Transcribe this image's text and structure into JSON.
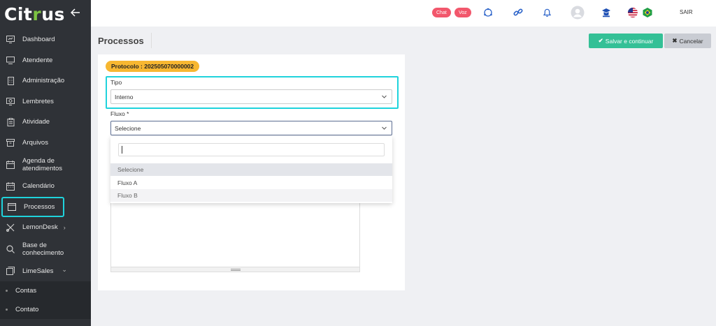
{
  "brand": {
    "name_prefix": "Cit",
    "name_leaf": "r",
    "name_suffix": "us",
    "back_icon": "arrow-left-icon"
  },
  "sidebar": {
    "items": [
      {
        "label": "Dashboard",
        "icon": "dashboard-icon"
      },
      {
        "label": "Atendente",
        "icon": "monitor-icon"
      },
      {
        "label": "Administração",
        "icon": "building-icon"
      },
      {
        "label": "Lembretes",
        "icon": "reminder-icon"
      },
      {
        "label": "Atividade",
        "icon": "clipboard-icon"
      },
      {
        "label": "Arquivos",
        "icon": "archive-icon"
      },
      {
        "label_line1": "Agenda de",
        "label_line2": "atendimentos",
        "icon": "calendar-icon"
      },
      {
        "label": "Calendário",
        "icon": "calendar-grid-icon"
      },
      {
        "label": "Processos",
        "icon": "window-icon",
        "active": true
      },
      {
        "label": "LemonDesk",
        "icon": "tools-icon",
        "caret": "›"
      },
      {
        "label_line1": "Base de",
        "label_line2": "conhecimento",
        "icon": "search-icon"
      },
      {
        "label": "LimeSales",
        "icon": "stack-icon",
        "caret": "⌄"
      }
    ],
    "sub_items": [
      {
        "label": "Contas"
      },
      {
        "label": "Contato"
      }
    ]
  },
  "topbar": {
    "chat_label": "Chat",
    "voz_label": "Voz",
    "icons": [
      "support-icon",
      "link-icon",
      "bell-icon",
      "avatar-icon",
      "graduation-icon",
      "us-flag-icon",
      "brazil-flag-icon"
    ],
    "sair_label": "SAIR"
  },
  "page": {
    "title": "Processos",
    "save_label": "Salvar e continuar",
    "cancel_label": "Cancelar",
    "accent_green": "#34c096",
    "highlight_cyan": "#1fd3dc"
  },
  "form": {
    "protocol_label": "Protocolo : 202505070000002",
    "tipo_label": "Tipo",
    "tipo_value": "Interno",
    "fluxo_label": "Fluxo *",
    "fluxo_value": "Selecione"
  },
  "dropdown": {
    "search_value": "",
    "options": [
      "Selecione",
      "Fluxo A",
      "Fluxo B"
    ],
    "selected": "Selecione"
  }
}
